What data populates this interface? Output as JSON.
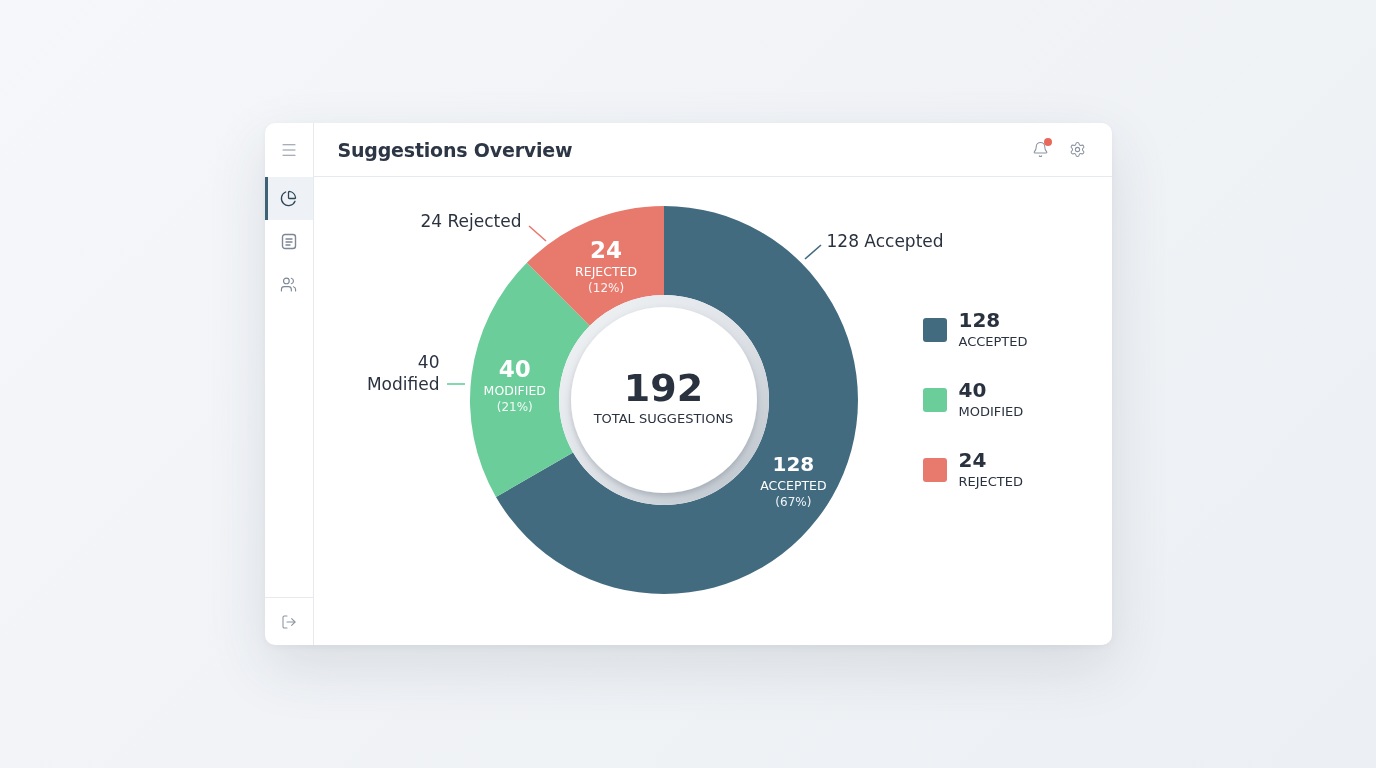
{
  "sidebar": {
    "items": [
      {
        "selected": true
      },
      {
        "selected": false
      },
      {
        "selected": false
      }
    ]
  },
  "header": {
    "title": "Suggestions Overview",
    "notifications": {
      "unread": true
    }
  },
  "chart": {
    "chart_data": {
      "type": "donut",
      "categories": [
        "ACCEPTED",
        "MODIFIED",
        "REJECTED"
      ],
      "values": [
        128,
        40,
        24
      ],
      "data_labels": true
    },
    "center": {
      "value": "192",
      "label": "TOTAL SUGGESTIONS"
    },
    "slices": [
      {
        "value": "128",
        "percent": "(67%)",
        "color": "#426b80",
        "callout": "128 Accepted"
      },
      {
        "value": "40",
        "percent": "(21%)",
        "color": "#6acd9a",
        "callout": "40 Modified"
      },
      {
        "value": "24",
        "percent": "(12%)",
        "color": "#e8796d",
        "callout": "24 Rejected"
      }
    ]
  },
  "legend": {
    "items": [
      {
        "value": "128",
        "label": "ACCEPTED",
        "color": "#426b80"
      },
      {
        "value": "40",
        "label": "MODIFIED",
        "color": "#6acd9a"
      },
      {
        "value": "24",
        "label": "REJECTED",
        "color": "#e8796d"
      }
    ]
  }
}
